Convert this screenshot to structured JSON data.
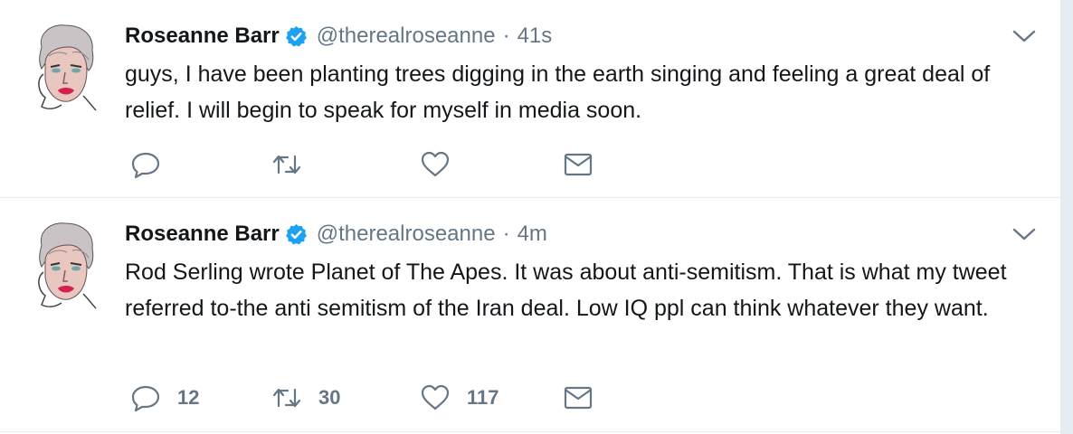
{
  "tweets": [
    {
      "name": "Roseanne Barr",
      "handle": "@therealroseanne",
      "separator": "·",
      "time": "41s",
      "text": "guys, I have been planting trees digging in the earth singing and feeling a great deal of relief. I will begin to speak for myself in media soon.",
      "reply_count": "",
      "retweet_count": "",
      "like_count": ""
    },
    {
      "name": "Roseanne Barr",
      "handle": "@therealroseanne",
      "separator": "·",
      "time": "4m",
      "text": "Rod Serling wrote Planet of The Apes. It was about anti-semitism. That is what my tweet referred to-the anti semitism of the Iran deal. Low IQ ppl can think whatever they want.",
      "reply_count": "12",
      "retweet_count": "30",
      "like_count": "117"
    }
  ],
  "icons": {
    "verified": "verified-badge-icon",
    "caret": "chevron-down-icon",
    "reply": "reply-icon",
    "retweet": "retweet-icon",
    "like": "heart-icon",
    "dm": "envelope-icon"
  },
  "colors": {
    "verified": "#1da1f2",
    "icon": "#657786",
    "text": "#14171a",
    "secondary": "#657786",
    "divider": "#e6ecf0"
  }
}
